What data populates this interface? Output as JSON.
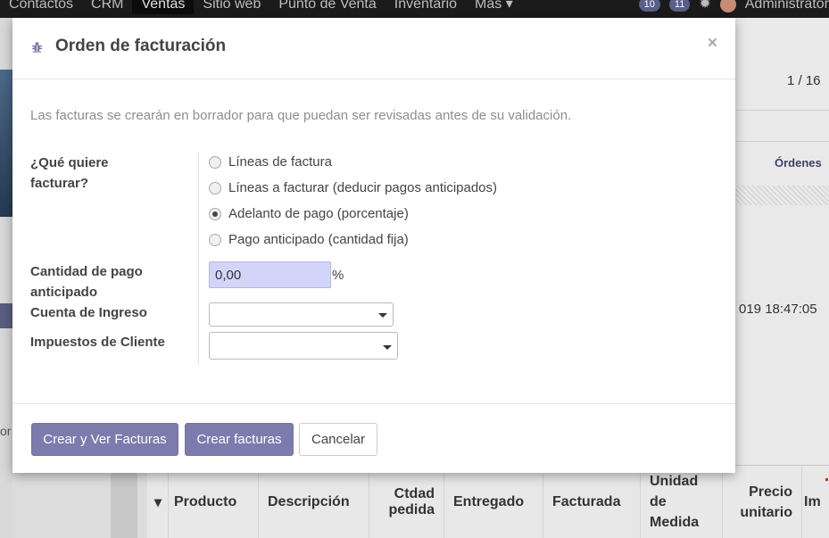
{
  "navbar": {
    "items": [
      "Contactos",
      "CRM",
      "Ventas",
      "Sitio web",
      "Punto de Venta",
      "Inventario",
      "Más"
    ],
    "active_index": 2,
    "badge_1": "10",
    "badge_2": "11",
    "user": "Administrator"
  },
  "background": {
    "pager": "1 / 16",
    "breadcrumb_fragment": "Órdenes",
    "date_fragment": "019 18:47:05",
    "left_text_fragment": "or"
  },
  "table": {
    "columns": [
      "Producto",
      "Descripción",
      "Ctdad pedida",
      "Entregado",
      "Facturada",
      "Unidad de Medida",
      "Precio unitario",
      "Im"
    ]
  },
  "modal": {
    "title": "Orden de facturación",
    "close_symbol": "×",
    "intro": "Las facturas se crearán en borrador para que puedan ser revisadas antes de su validación.",
    "fields": {
      "invoice_type_label": "¿Qué quiere facturar?",
      "options": [
        {
          "label": "Líneas de factura",
          "checked": false
        },
        {
          "label": "Líneas a facturar (deducir pagos anticipados)",
          "checked": false
        },
        {
          "label": "Adelanto de pago (porcentaje)",
          "checked": true
        },
        {
          "label": "Pago anticipado (cantidad fija)",
          "checked": false
        }
      ],
      "amount_label": "Cantidad de pago anticipado",
      "amount_value": "0,00",
      "amount_unit": "%",
      "income_account_label": "Cuenta de Ingreso",
      "income_account_value": "",
      "customer_taxes_label": "Impuestos de Cliente",
      "customer_taxes_value": ""
    },
    "buttons": {
      "create_view": "Crear y Ver Facturas",
      "create": "Crear facturas",
      "cancel": "Cancelar"
    }
  },
  "colors": {
    "primary": "#7c7bad",
    "input_highlight": "#d2d4fa",
    "navbar": "#1b1b1b"
  }
}
